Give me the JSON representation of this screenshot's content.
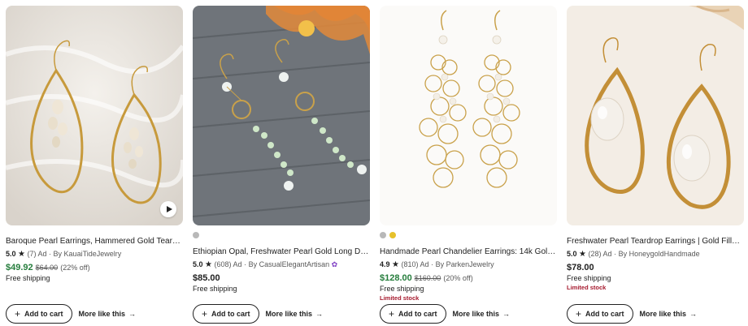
{
  "listings": [
    {
      "title": "Baroque Pearl Earrings, Hammered Gold Teardrop ...",
      "rating": "5.0",
      "reviews": "(7)",
      "ad": "Ad",
      "by": "By KauaiTideJewelry",
      "price": "$49.92",
      "original_price": "$64.00",
      "discount": "(22% off)",
      "shipping": "Free shipping",
      "limited": "",
      "swatches": [],
      "has_video": true
    },
    {
      "title": "Ethiopian Opal, Freshwater Pearl Gold Long Dangl...",
      "rating": "5.0",
      "reviews": "(608)",
      "ad": "Ad",
      "by": "By CasualElegantArtisan",
      "price": "$85.00",
      "original_price": "",
      "discount": "",
      "shipping": "Free shipping",
      "limited": "",
      "swatches": [
        "#b8b8b8"
      ],
      "star_seller": true
    },
    {
      "title": "Handmade Pearl Chandelier Earrings: 14k Gold-Pl...",
      "rating": "4.9",
      "reviews": "(810)",
      "ad": "Ad",
      "by": "By ParkenJewelry",
      "price": "$128.00",
      "original_price": "$160.00",
      "discount": "(20% off)",
      "shipping": "Free shipping",
      "limited": "Limited stock",
      "swatches": [
        "#b8b8b8",
        "#e6c12c"
      ]
    },
    {
      "title": "Freshwater Pearl Teardrop Earrings | Gold Filled D...",
      "rating": "5.0",
      "reviews": "(28)",
      "ad": "Ad",
      "by": "By HoneygoldHandmade",
      "price": "$78.00",
      "original_price": "",
      "discount": "",
      "shipping": "Free shipping",
      "limited": "Limited stock",
      "swatches": []
    }
  ],
  "actions": {
    "add_to_cart": "Add to cart",
    "more_like_this": "More like this"
  },
  "colors": {
    "sale_price": "#257d3c",
    "limited_stock": "#a61a2e",
    "star_seller": "#7f3fc4"
  }
}
